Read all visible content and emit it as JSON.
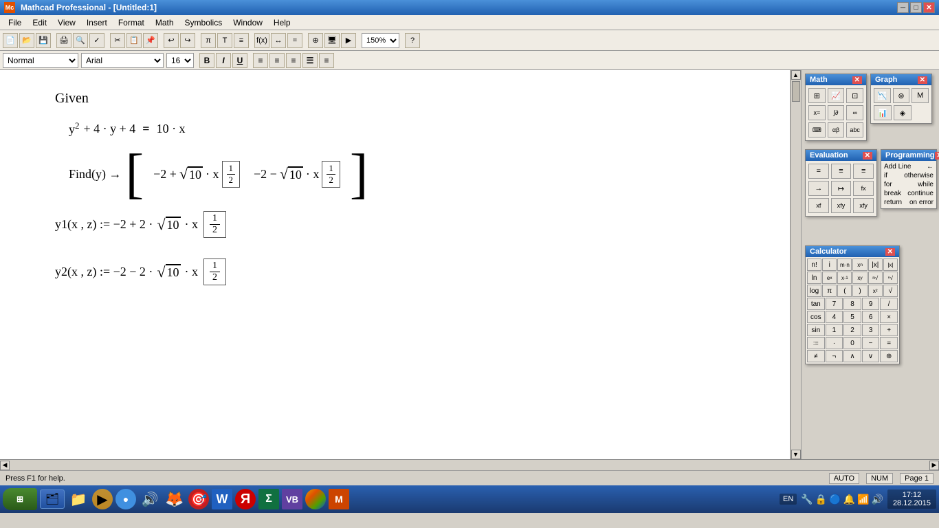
{
  "titlebar": {
    "title": "Mathcad Professional - [Untitled:1]",
    "app_icon": "Mc",
    "buttons": [
      "minimize",
      "maximize",
      "close"
    ]
  },
  "menubar": {
    "items": [
      "File",
      "Edit",
      "View",
      "Insert",
      "Format",
      "Math",
      "Symbolics",
      "Window",
      "Help"
    ]
  },
  "toolbar": {
    "zoom": "150%"
  },
  "formatbar": {
    "style": "Normal",
    "font": "Arial",
    "size": "16",
    "bold": "B",
    "italic": "I",
    "underline": "U"
  },
  "content": {
    "given_label": "Given",
    "equation1": "y² + 4 · y + 4 = 10 · x",
    "find_expr": "Find(y) →",
    "matrix_content": "[ −2 + √10 · x^(1/2)   −2 − √10 · x^(1/2) ]",
    "y1_def": "y1(x,z) := −2 + 2 · √10 · x^(1/2)",
    "y2_def": "y2(x,z) := −2 − 2 · √10 · x^(1/2)"
  },
  "panels": {
    "math": {
      "title": "Math",
      "buttons": [
        [
          "calc",
          "graph",
          "matrix"
        ],
        [
          "x=",
          "eval",
          "sym"
        ],
        [
          "prog",
          "greek",
          "abc"
        ]
      ]
    },
    "graph": {
      "title": "Graph",
      "visible": true
    },
    "evaluation": {
      "title": "Evaluation",
      "rows": [
        [
          "=",
          "≡",
          "≡"
        ],
        [
          "→",
          "↦",
          "fx"
        ],
        [
          "xf",
          "xfy",
          "xfy"
        ]
      ]
    },
    "programming": {
      "title": "Programming",
      "items": [
        "Add Line",
        "←",
        "if",
        "otherwise",
        "for",
        "while",
        "break",
        "continue",
        "return",
        "on error"
      ]
    },
    "calculator": {
      "title": "Calculator",
      "rows": [
        [
          "n!",
          "i",
          "m·n",
          "xn",
          "|x|"
        ],
        [
          "ln",
          "eˣ",
          "x⁻¹",
          "xʸ",
          "ⁿ√"
        ],
        [
          "log",
          "π",
          "(",
          ")",
          "x²",
          "√"
        ],
        [
          "tan",
          "7",
          "8",
          "9",
          "/"
        ],
        [
          "cos",
          "4",
          "5",
          "6",
          "×"
        ],
        [
          "sin",
          "1",
          "2",
          "3",
          "+"
        ],
        [
          ":=",
          "·",
          "0",
          "−",
          "="
        ]
      ],
      "extra_row": [
        "≠",
        "¬",
        "∧",
        "∨",
        "⊕"
      ]
    }
  },
  "statusbar": {
    "help": "Press F1 for help.",
    "auto": "AUTO",
    "num": "NUM",
    "page": "Page 1"
  },
  "taskbar": {
    "start_label": "⊞",
    "apps": [
      "🗂",
      "📁",
      "▶",
      "🔵",
      "🔊",
      "🦊",
      "🎯",
      "W",
      "Я",
      "Σ",
      "VB",
      "🎨",
      "M"
    ],
    "lang": "EN",
    "time": "17:12",
    "date": "28.12.2015"
  }
}
